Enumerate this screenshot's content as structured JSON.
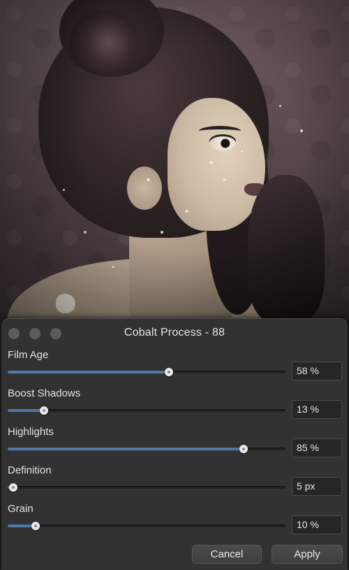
{
  "dialog": {
    "title": "Cobalt Process - 88",
    "window_controls": [
      "close-dot",
      "minimize-dot",
      "zoom-dot"
    ]
  },
  "params": [
    {
      "label": "Film Age",
      "value": "58 %",
      "level": 58
    },
    {
      "label": "Boost Shadows",
      "value": "13 %",
      "level": 13
    },
    {
      "label": "Highlights",
      "value": "85 %",
      "level": 85
    },
    {
      "label": "Definition",
      "value": "5 px",
      "level": 2
    },
    {
      "label": "Grain",
      "value": "10 %",
      "level": 10
    }
  ],
  "buttons": {
    "cancel": "Cancel",
    "apply": "Apply"
  },
  "colors": {
    "panel": "#323232",
    "slider_fill": "#4f78a8",
    "text": "#e2e2e2"
  }
}
